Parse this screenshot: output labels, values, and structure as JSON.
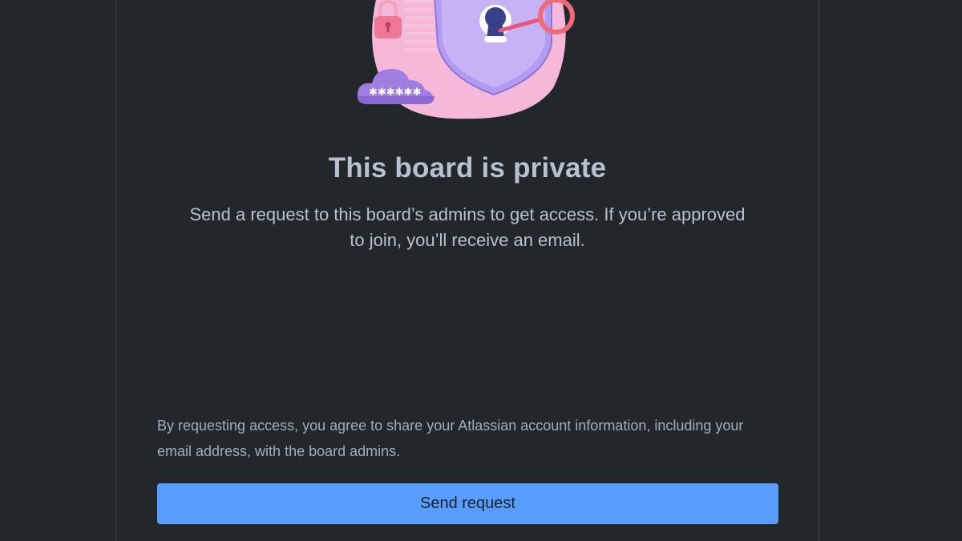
{
  "dialog": {
    "title": "This board is private",
    "message": "Send a request to this board’s admins to get access. If you’re approved to join, you’ll receive an email.",
    "disclaimer": "By requesting access, you agree to share your Atlassian account information, including your email address, with the board admins.",
    "send_label": "Send request"
  },
  "illustration": {
    "icons": [
      "shield-icon",
      "keyhole-icon",
      "key-icon",
      "padlock-icon",
      "password-cloud-icon"
    ],
    "colors": {
      "shield": "#b39cf0",
      "blob": "#f6b8d9",
      "key": "#f26a7a",
      "cloud": "#a07de0"
    }
  },
  "colors": {
    "background": "#22272b",
    "text": "#b6c2cf",
    "subtle_text": "#9fadbc",
    "primary_button": "#579dff"
  }
}
